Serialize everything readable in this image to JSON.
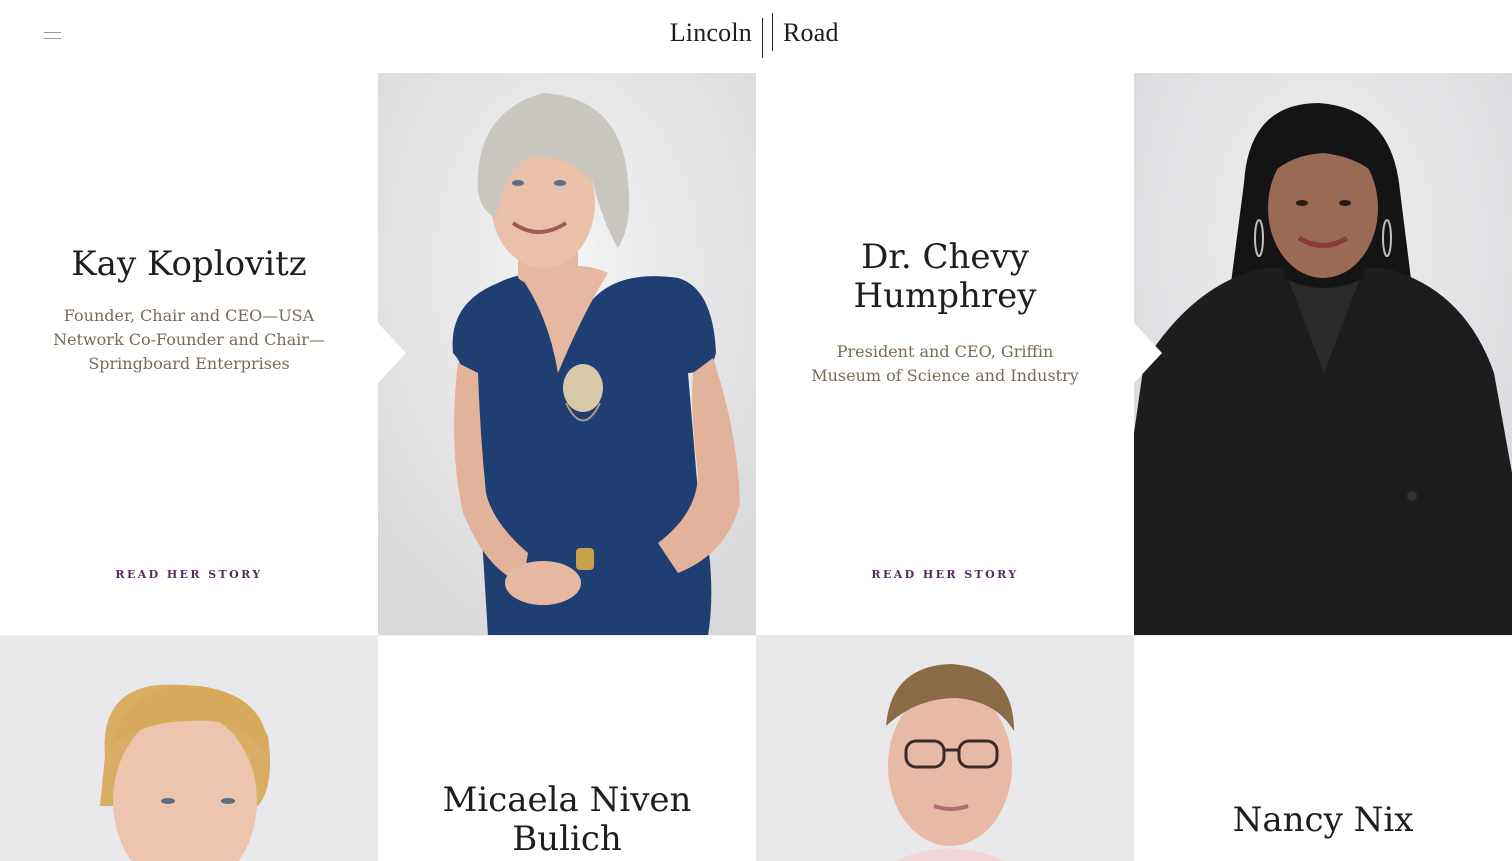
{
  "header": {
    "logo_left": "Lincoln",
    "logo_right": "Road",
    "menu_icon": "hamburger-menu-icon"
  },
  "cards": [
    {
      "name": "Kay Koplovitz",
      "role": "Founder, Chair and CEO—USA Network Co-Founder and Chair—Springboard Enterprises",
      "link": "READ HER STORY"
    },
    {
      "name": "Dr. Chevy Humphrey",
      "role": "President and CEO, Griffin Museum of Science and Industry",
      "link": "READ HER STORY"
    },
    {
      "name": "Micaela Niven Bulich"
    },
    {
      "name": "Nancy Nix"
    }
  ],
  "colors": {
    "background": "#ffffff",
    "photo_background": "#e6e6e8",
    "role_text": "#7a6a55",
    "link_text": "#5a2868",
    "name_text": "#1e1e1e"
  }
}
